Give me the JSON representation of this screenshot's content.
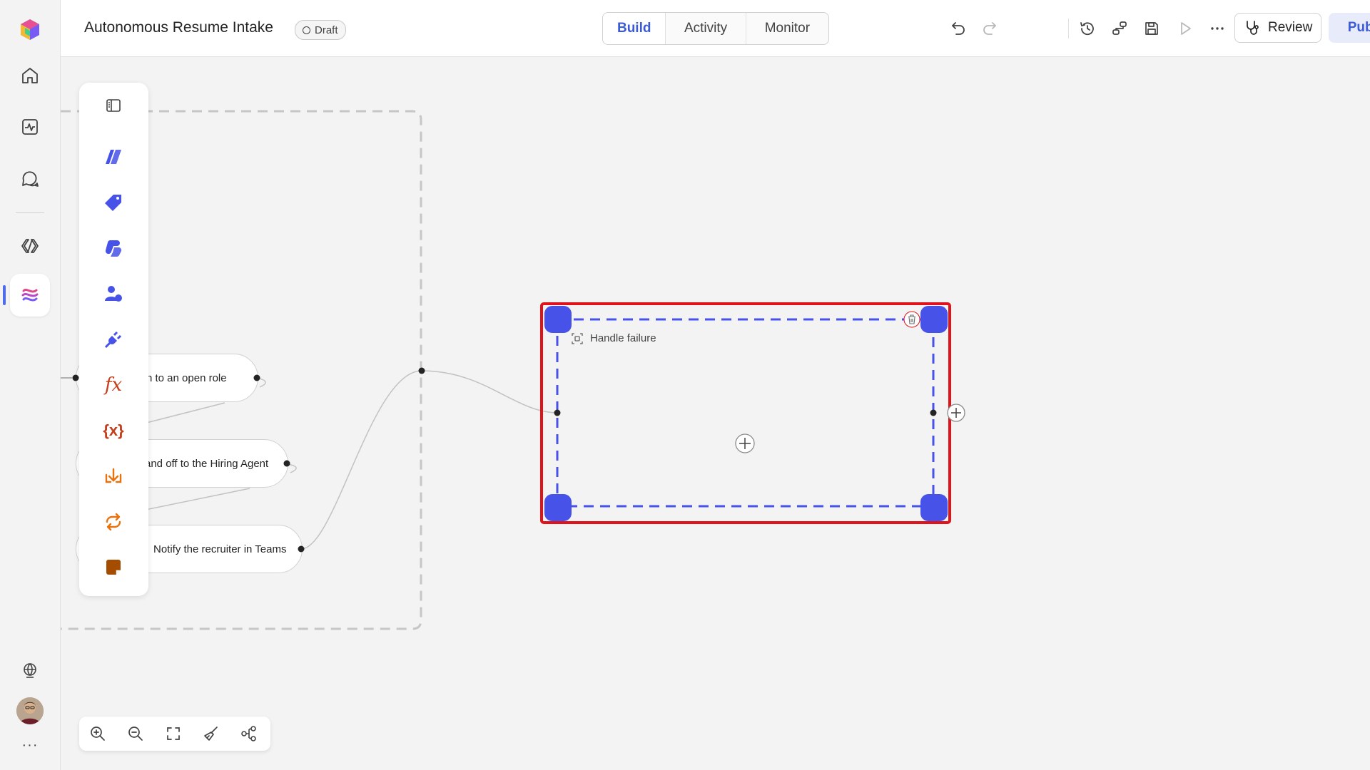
{
  "app": {
    "title": "Autonomous Resume Intake",
    "status_badge": "Draft"
  },
  "tabs": [
    {
      "label": "Build",
      "active": true
    },
    {
      "label": "Activity",
      "active": false
    },
    {
      "label": "Monitor",
      "active": false
    }
  ],
  "toolbar": {
    "icons": [
      "undo-icon",
      "redo-icon",
      "history-icon",
      "connections-icon",
      "save-icon",
      "run-icon",
      "more-icon"
    ],
    "review_label": "Review",
    "publish_label": "Publish"
  },
  "rail": {
    "icons": [
      "app-logo-icon",
      "home-icon",
      "activity-icon",
      "chat-icon",
      "code-icon",
      "workflows-icon",
      "globe-icon",
      "avatar",
      "more-icon"
    ],
    "more_label": "···"
  },
  "palette": {
    "icons": [
      "panel-toggle-icon",
      "agent-icon",
      "tag-icon",
      "copilot-icon",
      "person-icon",
      "plug-icon",
      "fx-icon",
      "variable-icon",
      "branch-icon",
      "loop-icon",
      "note-icon"
    ],
    "fx_label": "fx",
    "variable_label": "{x}"
  },
  "nodes": [
    {
      "label": "n to an open role"
    },
    {
      "label": "and off to the Hiring Agent"
    },
    {
      "label": "Notify the recruiter in Teams"
    }
  ],
  "group": {
    "title": "Handle failure"
  },
  "zoom_controls": [
    "zoom-in-icon",
    "zoom-out-icon",
    "fit-screen-icon",
    "clean-up-icon",
    "layout-icon"
  ],
  "colors": {
    "accent": "#3b5bdb",
    "selection_handle": "#4752e8",
    "highlight_frame": "#e0131b",
    "fx_red": "#c43e1c",
    "loop_orange": "#e8730c"
  }
}
